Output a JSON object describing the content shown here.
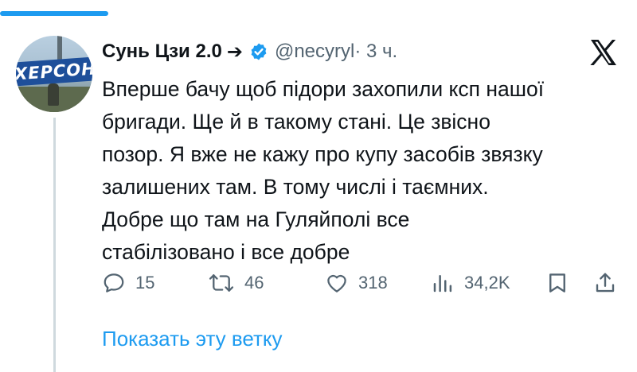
{
  "tweet": {
    "display_name": "Сунь Цзи 2.0",
    "name_arrow": "➔",
    "handle": "@necyryl",
    "time": " · 3 ч.",
    "avatar_sign_text": "ХЕРСОН",
    "text": "Вперше бачу щоб підори захопили ксп нашої\nбригади. Ще й в такому стані. Це звісно\nпозор. Я вже не кажу про купу засобів звязку\nзалишених там. В тому числі і таємних.\nДобре що там на Гуляйполі все\nстабілізовано і все добре"
  },
  "actions": {
    "replies": "15",
    "retweets": "46",
    "likes": "318",
    "views": "34,2K"
  },
  "show_thread": "Показать эту ветку",
  "icons": [
    "verified-badge-icon",
    "x-logo-icon",
    "reply-icon",
    "retweet-icon",
    "like-icon",
    "views-icon",
    "bookmark-icon",
    "share-icon"
  ],
  "colors": {
    "accent": "#1d9bf0",
    "secondary_text": "#536471",
    "primary_text": "#0f1419"
  }
}
